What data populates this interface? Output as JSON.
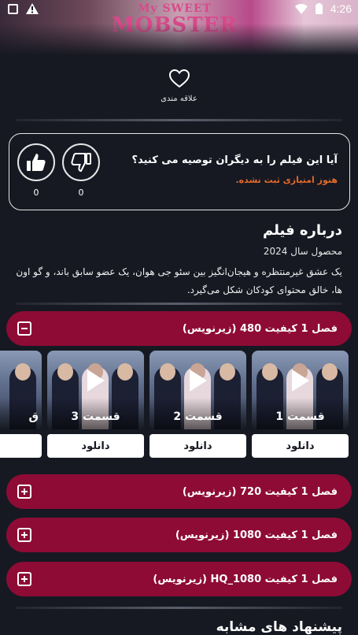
{
  "status_bar": {
    "time": "4:26"
  },
  "hero": {
    "title_small": "My SWEET",
    "title_big": "MOBSTER"
  },
  "favorite": {
    "label": "علاقه مندی"
  },
  "recommend": {
    "question": "آیا این فیلم را به دیگران توصیه می کنید؟",
    "no_rating": "هنوز امتیازی ثبت نشده.",
    "like_count": "0",
    "dislike_count": "0"
  },
  "about": {
    "title": "درباره فیلم",
    "year": "محصول سال 2024",
    "description": "یک عشق غیرمنتظره و هیجان‌انگیز بین سئو جی هوان، یک عضو سابق باند، و گو اون ها، خالق محتوای کودکان شکل می‌گیرد."
  },
  "seasons": [
    {
      "label": "فصل 1 کیفیت 480 (زیرنویس)",
      "expanded": true
    },
    {
      "label": "فصل 1 کیفیت 720 (زیرنویس)",
      "expanded": false
    },
    {
      "label": "فصل 1 کیفیت 1080 (زیرنویس)",
      "expanded": false
    },
    {
      "label": "فصل 1 کیفیت HQ_1080 (زیرنویس)",
      "expanded": false
    }
  ],
  "episodes": [
    {
      "name": "قسمت 1",
      "download": "دانلود"
    },
    {
      "name": "قسمت 2",
      "download": "دانلود"
    },
    {
      "name": "قسمت 3",
      "download": "دانلود"
    },
    {
      "name": "ق",
      "download": ""
    }
  ],
  "similar": {
    "title": "پیشنهاد های مشابه"
  },
  "colors": {
    "accent": "#8e0b36",
    "background": "#161922",
    "warning": "#e46a2a"
  }
}
